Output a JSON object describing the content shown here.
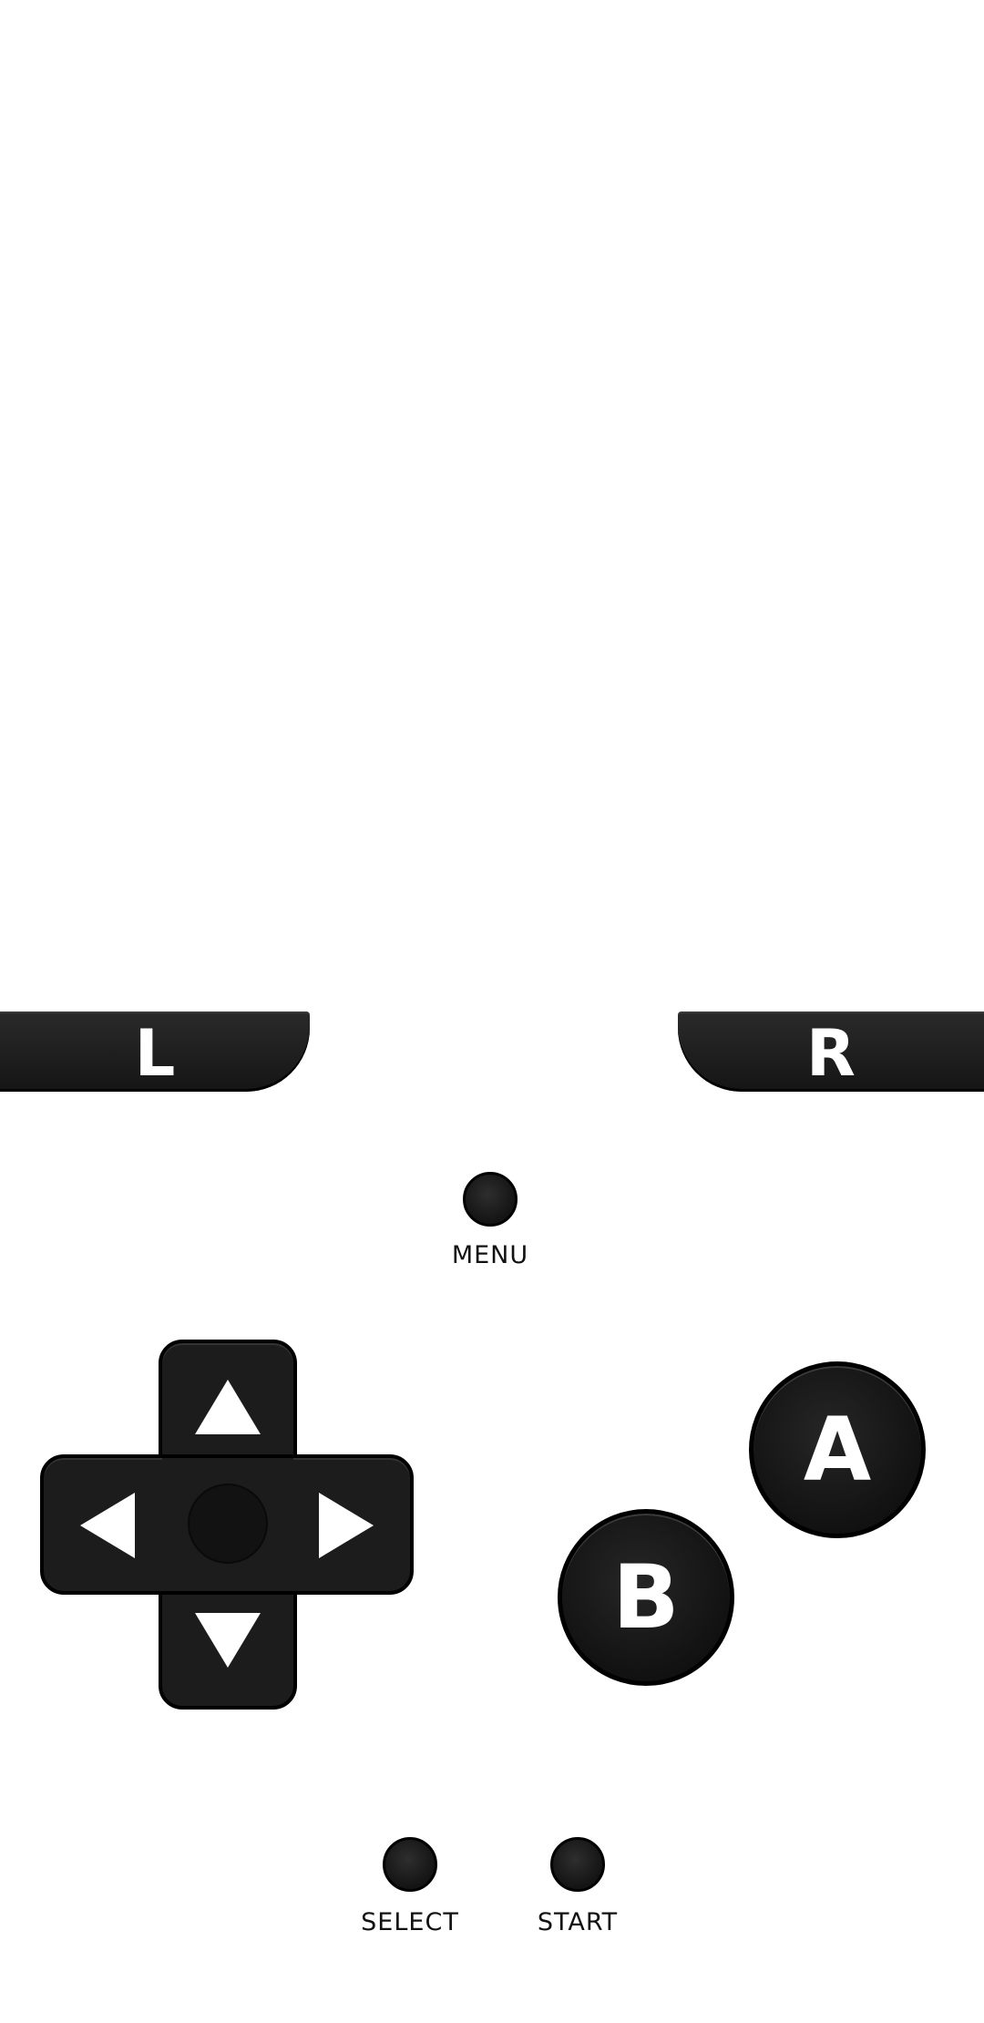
{
  "controls": {
    "shoulder_left": "L",
    "shoulder_right": "R",
    "menu_label": "MENU",
    "button_a": "A",
    "button_b": "B",
    "select_label": "SELECT",
    "start_label": "START"
  },
  "icons": {
    "dpad_up": "triangle-up",
    "dpad_down": "triangle-down",
    "dpad_left": "triangle-left",
    "dpad_right": "triangle-right"
  },
  "colors": {
    "button_fill": "#1c1c1c",
    "label_on_button": "#ffffff",
    "background": "#ffffff"
  }
}
